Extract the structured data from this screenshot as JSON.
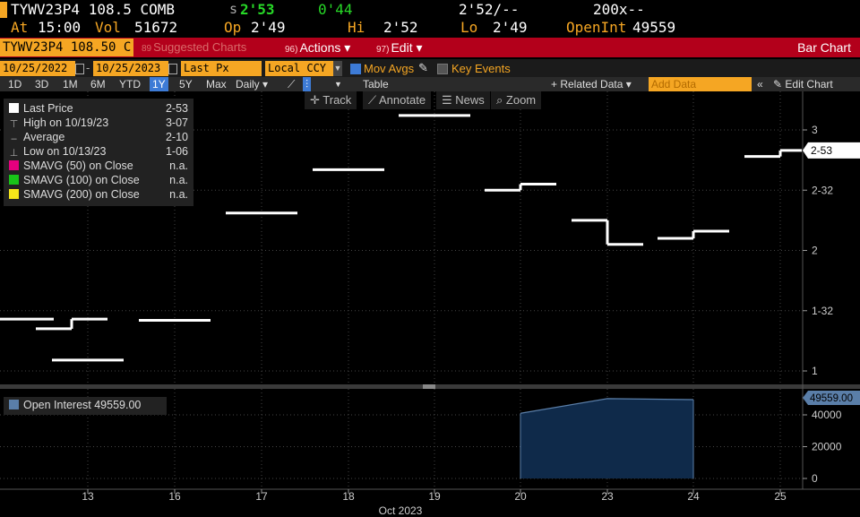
{
  "quote": {
    "ticker": "TYWV23P4 108.5 COMB",
    "last": "2'53",
    "last_prefix": "s",
    "change": "0'44",
    "bid_ask": "2'52/--",
    "size": "200x--",
    "time_label": "At",
    "time": "15:00",
    "vol_label": "Vol",
    "vol": "51672",
    "op_label": "Op",
    "op": "2'49",
    "hi_label": "Hi",
    "hi": "2'52",
    "lo_label": "Lo",
    "lo": "2'49",
    "oi_label": "OpenInt",
    "oi": "49559"
  },
  "titlebar": {
    "security": "TYWV23P4 108.50 C",
    "suggested": "Suggested Charts",
    "suggested_num": "89",
    "actions": "Actions ▾",
    "actions_num": "96)",
    "edit": "Edit ▾",
    "edit_num": "97)",
    "view": "Bar Chart"
  },
  "settings": {
    "start_date": "10/25/2022",
    "end_date": "10/25/2023",
    "field": "Last Px",
    "currency": "Local CCY",
    "mov_avgs": "Mov Avgs",
    "key_events": "Key Events"
  },
  "toolbar": {
    "periods": [
      "1D",
      "3D",
      "1M",
      "6M",
      "YTD",
      "1Y",
      "5Y",
      "Max"
    ],
    "selected_period": "1Y",
    "frequency": "Daily ▾",
    "table": "Table",
    "related": "+ Related Data ▾",
    "add_data_placeholder": "Add Data",
    "edit_chart": "Edit Chart"
  },
  "tools": {
    "track": "Track",
    "annotate": "Annotate",
    "news": "News",
    "zoom": "Zoom"
  },
  "legend": {
    "last_price": {
      "label": "Last Price",
      "value": "2-53"
    },
    "high": {
      "label": "High on 10/19/23",
      "value": "3-07"
    },
    "average": {
      "label": "Average",
      "value": "2-10"
    },
    "low": {
      "label": "Low on 10/13/23",
      "value": "1-06"
    },
    "sma50": {
      "label": "SMAVG (50)  on Close",
      "value": "n.a."
    },
    "sma100": {
      "label": "SMAVG (100)  on Close",
      "value": "n.a."
    },
    "sma200": {
      "label": "SMAVG (200)  on Close",
      "value": "n.a."
    },
    "oi": {
      "label": "Open Interest",
      "value": "49559.00"
    }
  },
  "colors": {
    "price": "#ffffff",
    "sma50": "#e6007e",
    "sma100": "#18c418",
    "sma200": "#f5e61a",
    "oi_fill": "#0f2a4a",
    "oi_line": "#5a7ea8",
    "accent": "#f5a623",
    "titlebar": "#b3001b"
  },
  "chart_data": [
    {
      "type": "bar",
      "title": "",
      "xlabel": "Oct 2023",
      "x_ticks": [
        "13",
        "16",
        "17",
        "18",
        "19",
        "20",
        "23",
        "24",
        "25"
      ],
      "y_ticks": [
        "1",
        "1-32",
        "2",
        "2-32",
        "3"
      ],
      "y_ticks_values": [
        1,
        1.5,
        2,
        2.5,
        3
      ],
      "last_label": "2-53",
      "ylim": [
        0.99,
        3.24
      ],
      "series": [
        {
          "name": "Last Price",
          "bars": [
            {
              "day": "10/11",
              "open": 1.43,
              "close": 1.43
            },
            {
              "day": "10/12",
              "open": 1.35,
              "close": 1.43
            },
            {
              "day": "10/13",
              "open": 1.09,
              "close": 1.09
            },
            {
              "day": "10/16",
              "open": 1.42,
              "close": 1.42
            },
            {
              "day": "10/17",
              "open": 2.31,
              "close": 2.31
            },
            {
              "day": "10/18",
              "open": 2.67,
              "close": 2.67
            },
            {
              "day": "10/19",
              "open": 3.12,
              "close": 3.12
            },
            {
              "day": "10/20",
              "open": 2.5,
              "close": 2.55
            },
            {
              "day": "10/23",
              "open": 2.25,
              "close": 2.05
            },
            {
              "day": "10/24",
              "open": 2.1,
              "close": 2.16
            },
            {
              "day": "10/25",
              "open": 2.78,
              "close": 2.83
            }
          ]
        }
      ]
    },
    {
      "type": "area",
      "title": "",
      "x_ticks": [
        "13",
        "16",
        "17",
        "18",
        "19",
        "20",
        "23",
        "24",
        "25"
      ],
      "y_ticks": [
        "0",
        "20000",
        "40000"
      ],
      "y_ticks_values": [
        0,
        20000,
        40000
      ],
      "ylim": [
        -2000,
        54000
      ],
      "last_label": "49559.00",
      "series": [
        {
          "name": "Open Interest",
          "x": [
            "10/20",
            "10/23",
            "10/24"
          ],
          "values": [
            41000,
            50200,
            49559
          ]
        }
      ]
    }
  ]
}
